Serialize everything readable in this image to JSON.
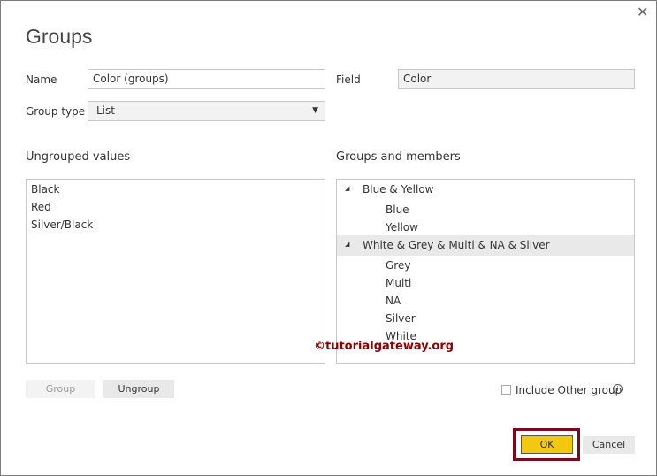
{
  "dialog": {
    "title": "Groups",
    "close_icon": "close-icon"
  },
  "form": {
    "name_label": "Name",
    "name_value": "Color (groups)",
    "field_label": "Field",
    "field_value": "Color",
    "group_type_label": "Group type",
    "group_type_value": "List"
  },
  "ungrouped": {
    "label": "Ungrouped values",
    "items": [
      "Black",
      "Red",
      "Silver/Black"
    ]
  },
  "groups": {
    "label": "Groups and members",
    "tree": [
      {
        "name": "Blue & Yellow",
        "members": [
          "Blue",
          "Yellow"
        ]
      },
      {
        "name": "White & Grey & Multi & NA & Silver",
        "members": [
          "Grey",
          "Multi",
          "NA",
          "Silver",
          "White"
        ]
      }
    ]
  },
  "buttons": {
    "group": "Group",
    "ungroup": "Ungroup",
    "ok": "OK",
    "cancel": "Cancel"
  },
  "include_other": {
    "label": "Include Other group",
    "checked": false
  },
  "watermark": "©tutorialgateway.org",
  "colors": {
    "ok": "#f2c811",
    "highlight": "#7b0a1e",
    "watermark": "#8b0000"
  }
}
